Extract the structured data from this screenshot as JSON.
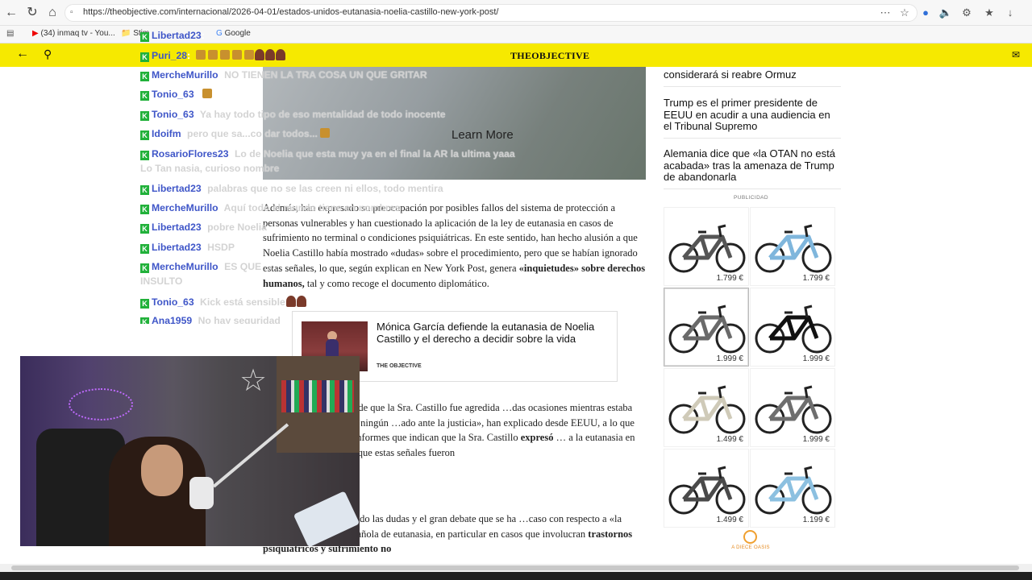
{
  "browser": {
    "url": "https://theobjective.com/internacional/2026-04-01/estados-unidos-eutanasia-noelia-castillo-new-york-post/",
    "bookmarks": [
      {
        "label": "(34) inmaq tv - You..."
      },
      {
        "label": "Stim"
      },
      {
        "label": "Google"
      }
    ]
  },
  "site": {
    "logo": "THEOBJECTIVE"
  },
  "article": {
    "video_cta": "Learn More",
    "para1": "Además, han expresado su preocupación por posibles fallos del sistema de protección a personas vulnerables y han cuestionado la aplicación de la ley de eutanasia en casos de sufrimiento no terminal o condiciones psiquiátricas. En este sentido, han hecho alusión a que Noelia Castillo había mostrado «dudas» sobre el procedimiento, pero que se habían ignorado estas señales, lo que, según explican en New York Post, genera",
    "para1_bold": "«inquietudes» sobre derechos humanos,",
    "para1_end": " tal y como recoge el documento diplomático.",
    "related": {
      "title": "Mónica García defiende la eutanasia de Noelia Castillo y el derecho a decidir sobre la vida",
      "source": "THE OBJECTIVE"
    },
    "para2": "…damente la denuncia de que la Sra. Castillo fue agredida …das ocasiones mientras estaba bajo tutela estatal y que ningún …ado ante la justicia», han explicado desde EEUU, a lo que han …nocimientos de informes que indican que la Sra. Castillo",
    "para2_bold": "expresó",
    "para2_end": " … a la eutanasia en sus últimas horas, pero que estas señales fueron",
    "para3": "…nto concluye mostrando las dudas y el gran debate que se ha …caso con respecto a «la aplicación de la ley española de eutanasia, en particular en casos que involucran",
    "para3_bold": "trastornos psiquiátricos y sufrimiento no"
  },
  "sidebar": {
    "news": [
      {
        "title": "considerará si reabre Ormuz"
      },
      {
        "title": "Trump es el primer presidente de EEUU en acudir a una audiencia en el Tribunal Supremo"
      },
      {
        "title": "Alemania dice que «la OTAN no está acabada» tras la amenaza de Trump de abandonarla"
      }
    ],
    "ad_label": "PUBLICIDAD",
    "ad_brand": "A DIECE OASIS",
    "ads": [
      {
        "price": "1.799 €",
        "color": "#555555"
      },
      {
        "price": "1.799 €",
        "color": "#7fb6dc"
      },
      {
        "price": "1.999 €",
        "color": "#6a6a6a"
      },
      {
        "price": "1.999 €",
        "color": "#111111"
      },
      {
        "price": "1.499 €",
        "color": "#cfcab8"
      },
      {
        "price": "1.999 €",
        "color": "#6e6e6e"
      },
      {
        "price": "1.499 €",
        "color": "#4a4a4a"
      },
      {
        "price": "1.199 €",
        "color": "#8cc0e0"
      }
    ]
  },
  "chat": [
    {
      "user": "Libertad23",
      "msg": ""
    },
    {
      "user": "Puri_28",
      "msg": ""
    },
    {
      "user": "MercheMurillo",
      "msg": "NO TIENEN LA TRA COSA UN QUE GRITAR"
    },
    {
      "user": "Tonio_63",
      "msg": ""
    },
    {
      "user": "Tonio_63",
      "msg": "Ya hay todo tipo de eso mentalidad de todo inocente"
    },
    {
      "user": "Idoifm",
      "msg": "pero que sa...co dar todos..."
    },
    {
      "user": "RosarioFlores23",
      "msg": "Lo de Noelia que esta muy ya en el final la AR la ultima yaaa"
    },
    {
      "user": "",
      "msg": "Lo Tan nasia, curioso nombre"
    },
    {
      "user": "Libertad23",
      "msg": "palabras que no se las creen ni ellos, todo mentira"
    },
    {
      "user": "MercheMurillo",
      "msg": "Aquí todo el mundo tiene en nombres"
    },
    {
      "user": "Libertad23",
      "msg": "pobre Noelia"
    },
    {
      "user": "Libertad23",
      "msg": "HSDP"
    },
    {
      "user": "MercheMurillo",
      "msg": "ES QUE ..."
    },
    {
      "user": "",
      "msg": "INSULTO"
    },
    {
      "user": "Tonio_63",
      "msg": "Kick está sensible"
    },
    {
      "user": "Ana1959",
      "msg": "No hay seguridad"
    }
  ]
}
